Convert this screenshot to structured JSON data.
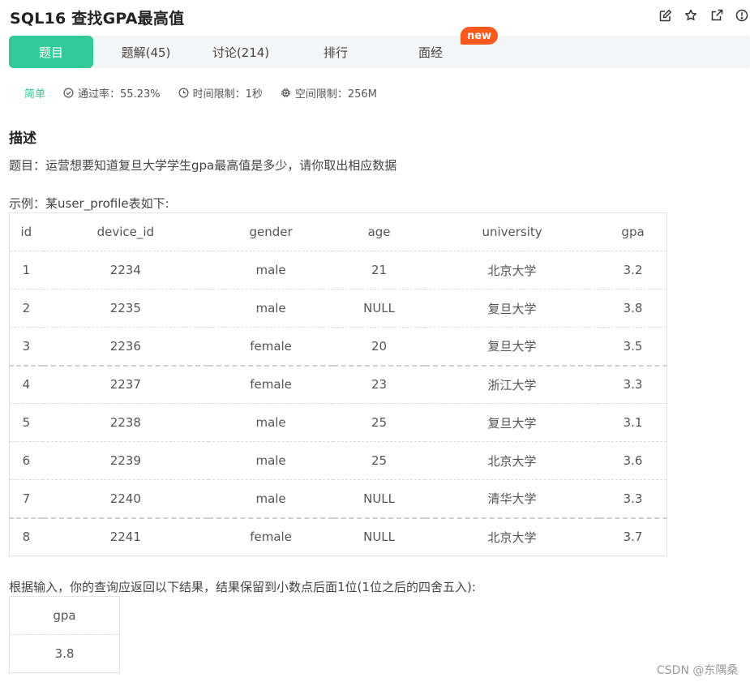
{
  "header": {
    "title": "SQL16  查找GPA最高值",
    "icons": [
      "edit-icon",
      "star-icon",
      "external-link-icon",
      "alert-icon"
    ]
  },
  "tabs": [
    {
      "label": "题目",
      "active": true
    },
    {
      "label": "题解(45)"
    },
    {
      "label": "讨论(214)"
    },
    {
      "label": "排行"
    },
    {
      "label": "面经"
    }
  ],
  "new_badge": "new",
  "meta": {
    "level": "简单",
    "pass_rate": "通过率：55.23%",
    "time_limit": "时间限制：1秒",
    "space_limit": "空间限制：256M"
  },
  "content": {
    "section_title": "描述",
    "question": "题目：运营想要知道复旦大学学生gpa最高值是多少，请你取出相应数据",
    "example_intro": "示例：某user_profile表如下:",
    "table_headers": [
      "id",
      "device_id",
      "gender",
      "age",
      "university",
      "gpa"
    ],
    "table_rows": [
      [
        "1",
        "2234",
        "male",
        "21",
        "北京大学",
        "3.2"
      ],
      [
        "2",
        "2235",
        "male",
        "NULL",
        "复旦大学",
        "3.8"
      ],
      [
        "3",
        "2236",
        "female",
        "20",
        "复旦大学",
        "3.5"
      ],
      [
        "4",
        "2237",
        "female",
        "23",
        "浙江大学",
        "3.3"
      ],
      [
        "5",
        "2238",
        "male",
        "25",
        "复旦大学",
        "3.1"
      ],
      [
        "6",
        "2239",
        "male",
        "25",
        "北京大学",
        "3.6"
      ],
      [
        "7",
        "2240",
        "male",
        "NULL",
        "清华大学",
        "3.3"
      ],
      [
        "8",
        "2241",
        "female",
        "NULL",
        "北京大学",
        "3.7"
      ]
    ],
    "result_intro": "根据输入，你的查询应返回以下结果，结果保留到小数点后面1位(1位之后的四舍五入):",
    "result_header": "gpa",
    "result_value": "3.8"
  },
  "watermark": "CSDN @东隅桑",
  "colors": {
    "accent": "#32ca99",
    "badge": "#fa5a1e"
  }
}
